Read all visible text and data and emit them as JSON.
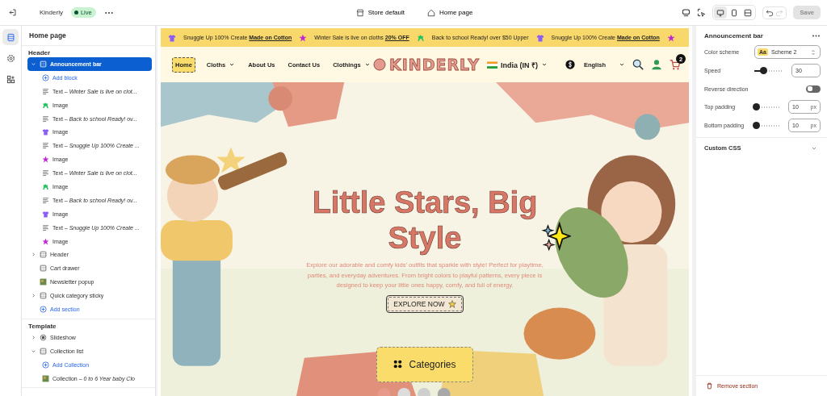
{
  "topbar": {
    "store": "Kinderly",
    "status": "Live",
    "theme": "Store default",
    "page": "Home page",
    "devices": [
      {
        "kind": "desktop",
        "selected": true
      },
      {
        "kind": "tablet",
        "selected": false
      },
      {
        "kind": "fullwidth",
        "selected": false
      }
    ],
    "save": {
      "label": "Save",
      "disabled": true
    }
  },
  "rail": [
    {
      "kind": "sections",
      "selected": true
    },
    {
      "kind": "settings",
      "selected": false
    },
    {
      "kind": "apps",
      "selected": false
    }
  ],
  "sidebar": {
    "title": "Home page",
    "groups": [
      {
        "heading": "Header",
        "sections": [
          {
            "label": "Announcement bar",
            "kind": "section",
            "selected": true,
            "expanded": true,
            "children": [
              {
                "kind": "add",
                "label": "Add block"
              },
              {
                "kind": "text",
                "label": "Text – *Winter Sale is live on clot...*"
              },
              {
                "kind": "dog",
                "label": "Image",
                "color": "#22c55e"
              },
              {
                "kind": "text",
                "label": "Text – *Back to school Ready! ov...*"
              },
              {
                "kind": "shirt",
                "label": "Image",
                "color": "#8b5cf6"
              },
              {
                "kind": "text",
                "label": "Text – *Snuggle Up 100% Create ...*"
              },
              {
                "kind": "star",
                "label": "Image",
                "color": "#c026d3"
              },
              {
                "kind": "text",
                "label": "Text – *Winter Sale is live on clot...*"
              },
              {
                "kind": "dog",
                "label": "Image",
                "color": "#22c55e"
              },
              {
                "kind": "text",
                "label": "Text – *Back to school Ready! ov...*"
              },
              {
                "kind": "shirt",
                "label": "Image",
                "color": "#8b5cf6"
              },
              {
                "kind": "text",
                "label": "Text – *Snuggle Up 100% Create ...*"
              },
              {
                "kind": "star",
                "label": "Image",
                "color": "#c026d3"
              }
            ]
          },
          {
            "label": "Header",
            "kind": "section",
            "selected": false,
            "expanded": false
          },
          {
            "label": "Cart drawer",
            "kind": "section",
            "selected": false
          },
          {
            "label": "Newsletter popup",
            "kind": "thumb",
            "selected": false
          },
          {
            "label": "Quick category sticky",
            "kind": "section",
            "selected": false,
            "expanded": false
          }
        ],
        "add": "Add section"
      },
      {
        "heading": "Template",
        "sections": [
          {
            "label": "Slideshow",
            "kind": "slideshow",
            "selected": false,
            "expanded": false
          },
          {
            "label": "Collection list",
            "kind": "section",
            "selected": false,
            "expanded": true,
            "children": [
              {
                "kind": "add",
                "label": "Add Collection"
              },
              {
                "kind": "thumb",
                "label": "Collection – *0 to 6 Year baby Clo*"
              }
            ]
          }
        ]
      }
    ]
  },
  "preview": {
    "announcement": [
      {
        "kind": "shirt",
        "color": "#8b5cf6"
      },
      {
        "kind": "text",
        "text": "Snuggle Up 100% Create **Made on Cotton**"
      },
      {
        "kind": "star",
        "color": "#c026d3"
      },
      {
        "kind": "text",
        "text": "Winter Sale is live on cloths **20% OFF**"
      },
      {
        "kind": "dog",
        "color": "#22c55e"
      },
      {
        "kind": "text",
        "text": "Back to school Ready! over $50 Upper"
      },
      {
        "kind": "shirt",
        "color": "#8b5cf6"
      },
      {
        "kind": "text",
        "text": "Snuggle Up 100% Create **Made on Cotton**"
      },
      {
        "kind": "star",
        "color": "#c026d3"
      }
    ],
    "nav": {
      "menu": [
        {
          "label": "Home",
          "selected": true,
          "dropdown": false
        },
        {
          "label": "Cloths",
          "selected": false,
          "dropdown": true
        },
        {
          "label": "About Us",
          "selected": false,
          "dropdown": false
        },
        {
          "label": "Contact Us",
          "selected": false,
          "dropdown": false
        },
        {
          "label": "Clothings",
          "selected": false,
          "dropdown": true
        }
      ],
      "logo": "KINDERLY",
      "country": "India (IN ₹)",
      "language": "English",
      "cart_count": "2"
    },
    "hero": {
      "title": "Little Stars, Big Style",
      "text": "Explore our adorable and comfy kids' outfits that sparkle with style! Perfect for playtime, parties, and everyday adventures. From bright colors to playful patterns, every piece is designed to keep your little ones happy, comfy, and full of energy.",
      "button": "EXPLORE NOW",
      "categories": "Categories"
    }
  },
  "settings": {
    "title": "Announcement bar",
    "fields": [
      {
        "kind": "select",
        "label": "Color scheme",
        "swatch": "Aa",
        "value": "Scheme 2"
      },
      {
        "kind": "slider",
        "label": "Speed",
        "level": 0.3,
        "value": "30"
      },
      {
        "kind": "toggle",
        "label": "Reverse direction",
        "on": false
      },
      {
        "kind": "slider",
        "label": "Top padding",
        "level": 0.05,
        "value": "10",
        "unit": "px"
      },
      {
        "kind": "slider",
        "label": "Bottom padding",
        "level": 0.05,
        "value": "10",
        "unit": "px"
      }
    ],
    "collapsible": {
      "label": "Custom CSS",
      "expanded": false
    },
    "remove": "Remove section"
  }
}
